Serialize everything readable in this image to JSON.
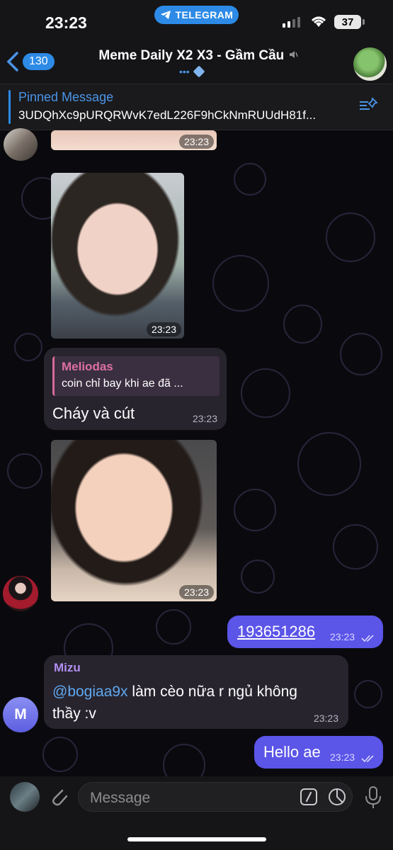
{
  "status": {
    "time": "23:23",
    "app_pill": "TELEGRAM",
    "battery": "37"
  },
  "header": {
    "back_count": "130",
    "title": "Meme Daily X2 X3 - Gầm Cầu",
    "subtitle": "•••"
  },
  "pinned": {
    "title": "Pinned Message",
    "text": "3UDQhXc9pURQRWvK7edL226F9hCkNmRUUdH81f..."
  },
  "messages": [
    {
      "type": "photo",
      "time": "23:23"
    },
    {
      "type": "photo",
      "time": "23:23"
    },
    {
      "type": "text",
      "reply_name": "Meliodas",
      "reply_text": "coin chỉ bay khi ae đã ...",
      "text": "Cháy và cút",
      "time": "23:23"
    },
    {
      "type": "photo",
      "time": "23:23"
    },
    {
      "type": "text",
      "direction": "out",
      "text": "193651286",
      "time": "23:23"
    },
    {
      "type": "text",
      "sender": "Mizu",
      "sender_initial": "M",
      "mention": "@bogiaa9x",
      "text_line1": " làm cèo nữa r ngủ không",
      "text_line2": "thầy :v",
      "time": "23:23"
    },
    {
      "type": "text",
      "direction": "out",
      "text": "Hello ae",
      "time": "23:23"
    }
  ],
  "composer": {
    "placeholder": "Message"
  },
  "colors": {
    "accent": "#2d8ae6",
    "outgoing": "#5b55e8",
    "incoming": "#27242e",
    "reply_name": "#de6fa5",
    "sender_mizu": "#b18ef0"
  }
}
